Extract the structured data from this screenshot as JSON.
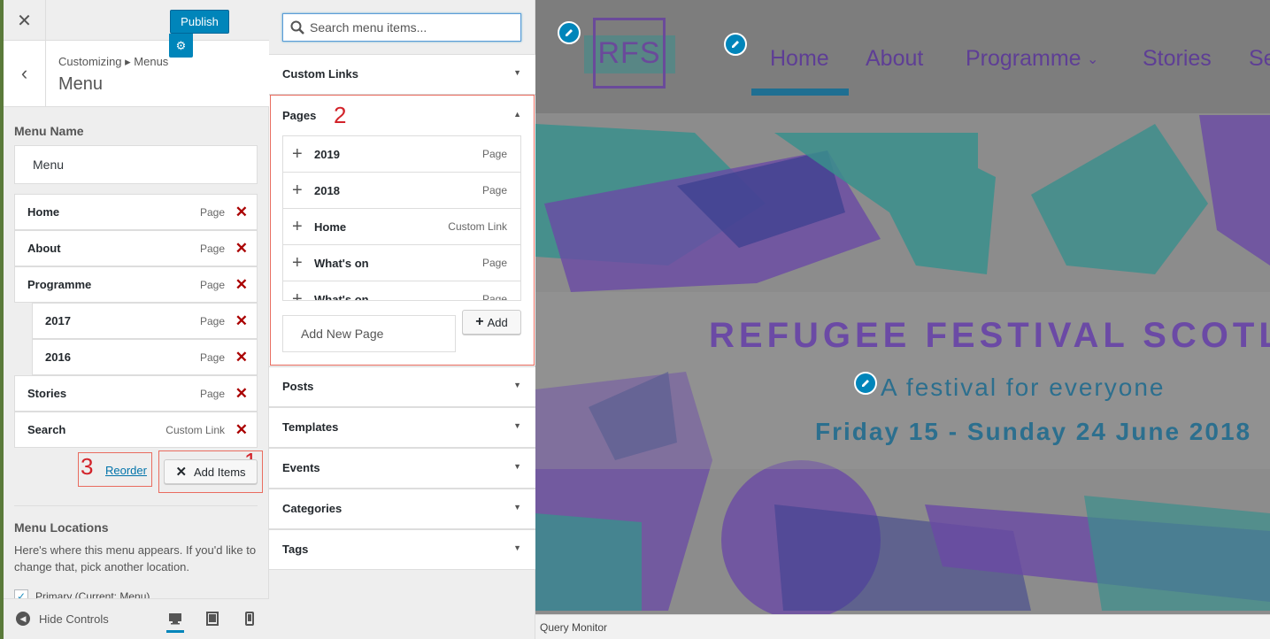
{
  "header": {
    "close_icon": "close-icon",
    "publish_label": "Publish",
    "settings_icon": "gear-icon"
  },
  "section": {
    "breadcrumb": "Customizing ▸ Menus",
    "title": "Menu"
  },
  "menu_name": {
    "label": "Menu Name",
    "value": "Menu"
  },
  "menu_items": [
    {
      "title": "Home",
      "type": "Page"
    },
    {
      "title": "About",
      "type": "Page"
    },
    {
      "title": "Programme",
      "type": "Page"
    },
    {
      "title": "2017",
      "type": "Page"
    },
    {
      "title": "2016",
      "type": "Page"
    },
    {
      "title": "Stories",
      "type": "Page"
    },
    {
      "title": "Search",
      "type": "Custom Link"
    }
  ],
  "actions": {
    "reorder_label": "Reorder",
    "add_items_label": "Add Items"
  },
  "annotations": {
    "one": "1",
    "two": "2",
    "three": "3",
    "color": "#d2232a"
  },
  "locations": {
    "title": "Menu Locations",
    "description": "Here's where this menu appears. If you'd like to change that, pick another location.",
    "primary_label": "Primary (Current: Menu)"
  },
  "footer": {
    "hide_controls_label": "Hide Controls"
  },
  "available": {
    "search_placeholder": "Search menu items...",
    "custom_links": "Custom Links",
    "pages": {
      "title": "Pages",
      "items": [
        {
          "title": "2019",
          "type": "Page"
        },
        {
          "title": "2018",
          "type": "Page"
        },
        {
          "title": "Home",
          "type": "Custom Link"
        },
        {
          "title": "What's on",
          "type": "Page"
        },
        {
          "title": "What's on",
          "type": "Page"
        }
      ],
      "new_page_placeholder": "Add New Page",
      "add_label": "Add"
    },
    "sections": [
      "Posts",
      "Templates",
      "Events",
      "Categories",
      "Tags"
    ]
  },
  "preview": {
    "logo": "RFS",
    "nav": [
      "Home",
      "About",
      "Programme",
      "Stories",
      "Se"
    ],
    "hero_title": "REFUGEE FESTIVAL SCOTL",
    "hero_subtitle": "A festival for everyone",
    "hero_date": "Friday 15 - Sunday 24 June 2018",
    "query_monitor": "Query Monitor"
  },
  "colors": {
    "accent": "#0085ba",
    "delete": "#a00000",
    "highlight_box": "#e96c5f",
    "nav_purple": "#5e3e95",
    "hero_teal": "#2c6f8e"
  }
}
